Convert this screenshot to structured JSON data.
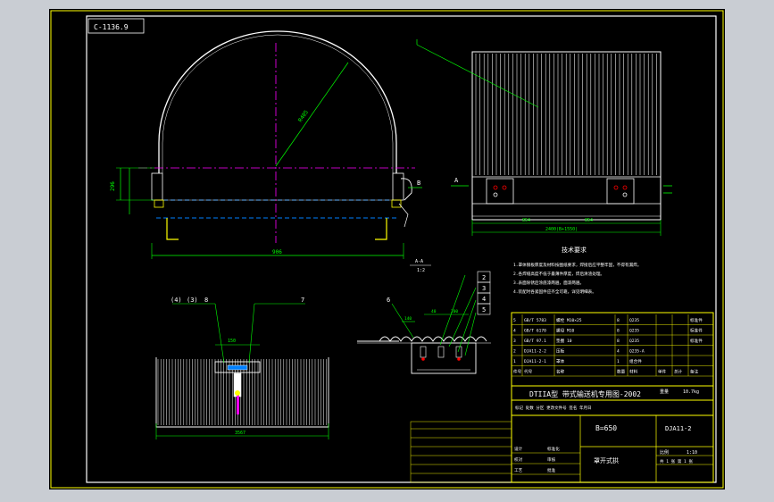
{
  "drawing": {
    "code_box": "C-1136.9",
    "sheet_title": "DTIIA型 带式输送机专用图-2002",
    "belt_width": "B=650",
    "drawing_no": "DJA11-2",
    "part_name": "罩开式拱",
    "section_label_a": "A",
    "section_label_b": "B",
    "view_label_1": "A-A",
    "view_label_2": "1:2",
    "notes_title": "技术要求",
    "notes": [
      "1.罩体钢板厚度及材料按图纸要求，焊接后应平整牢固，不得有漏焊。",
      "2.各焊缝高度不低于最薄件厚度，焊后清渣处理。",
      "3.表面除锈后涂底漆两遍，面漆两遍。",
      "4.装配时各紧固件应齐全可靠，详见明细表。"
    ],
    "callouts": [
      "(4)",
      "(3)",
      "8",
      "7",
      "6",
      "2",
      "3",
      "4",
      "5"
    ],
    "dims": {
      "overall_width": "906",
      "height": "296",
      "radius": "R405",
      "span": "2400(B+1550)",
      "pitch_a": "854",
      "pitch_b": "854",
      "detail_top": "150",
      "detail_bottom": "3567",
      "small_1": "140",
      "small_2": "40",
      "small_3": "200"
    },
    "bom_headers": [
      "件号",
      "代号",
      "名称",
      "数量",
      "材料",
      "单件",
      "总计",
      "备注"
    ],
    "bom_rows": [
      [
        "5",
        "GB/T 5783",
        "螺栓 M10×25",
        "8",
        "Q235",
        "",
        "",
        "标准件"
      ],
      [
        "4",
        "GB/T 6170",
        "螺母 M10",
        "8",
        "Q235",
        "",
        "",
        "标准件"
      ],
      [
        "3",
        "GB/T 97.1",
        "垫圈 10",
        "8",
        "Q235",
        "",
        "",
        "标准件"
      ],
      [
        "2",
        "DJA11-2-2",
        "压板",
        "4",
        "Q235-A",
        "",
        "",
        ""
      ],
      [
        "1",
        "DJA11-2-1",
        "罩体",
        "1",
        "组合件",
        "",
        "",
        ""
      ]
    ],
    "mass_label": "重量",
    "mass_value": "10.7kg",
    "scale_label": "比例",
    "scale_value": "1:10",
    "footer_left": "标记 处数 分区 更改文件号 签名 年月日",
    "footer_rows": [
      [
        "设计",
        "",
        "标准化",
        ""
      ],
      [
        "校对",
        "",
        "审核",
        ""
      ],
      [
        "工艺",
        "",
        "批准",
        ""
      ]
    ],
    "sheet_info": "共 1 张 第 1 张"
  },
  "colors": {
    "background": "#000000",
    "frame": "#ffffff",
    "title_block": "#ffff00",
    "dimension": "#00ff00",
    "centerline": "#ff00ff",
    "profile": "#ffffff",
    "hidden": "#0080ff",
    "accent": "#ff0000"
  }
}
